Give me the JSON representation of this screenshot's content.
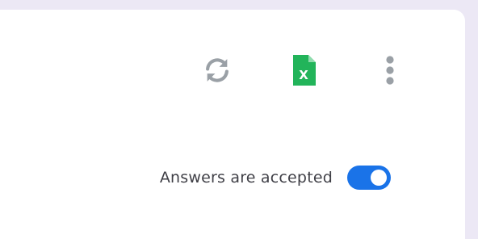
{
  "header": {
    "icons": {
      "refresh": "refresh-icon",
      "sheets": "spreadsheet-icon",
      "more": "more-vertical-icon"
    },
    "sheets_icon_letter": "X"
  },
  "responses": {
    "accepting_label": "Answers are accepted",
    "accepting_enabled": true
  },
  "colors": {
    "toggle_on": "#1a73e8",
    "sheets_green": "#22b45a",
    "icon_gray": "#9aa0a6",
    "label_text": "#3f3f46",
    "page_background": "#ece8f5"
  }
}
